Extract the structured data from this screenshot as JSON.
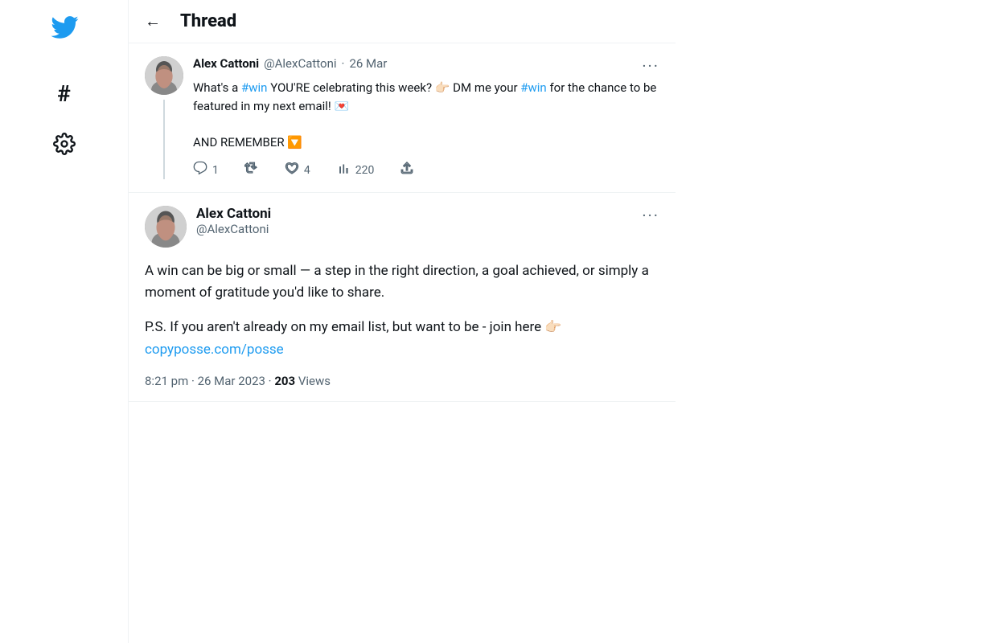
{
  "sidebar": {
    "logo": "🐦",
    "items": [
      {
        "icon": "#",
        "name": "explore",
        "label": "Explore"
      },
      {
        "icon": "⚙",
        "name": "settings",
        "label": "Settings"
      }
    ]
  },
  "header": {
    "back_label": "←",
    "title": "Thread"
  },
  "tweet1": {
    "author_name": "Alex Cattoni",
    "author_handle": "@AlexCattoni",
    "date": "26 Mar",
    "body_before_win1": "What's a ",
    "win_link1": "#win",
    "body_middle": " YOU'RE celebrating this week? 👉🏻 DM me your ",
    "win_link2": "#win",
    "body_after": " for the chance to be featured in my next email! 💌",
    "body2": "AND REMEMBER 🔽",
    "actions": {
      "reply_count": "1",
      "retweet_count": "",
      "like_count": "4",
      "views_count": "220"
    }
  },
  "tweet2": {
    "author_name": "Alex Cattoni",
    "author_handle": "@AlexCattoni",
    "body1": "A win can be big or small — a step in the right direction, a goal achieved, or simply a moment of gratitude you'd like to share.",
    "body2_before": "P.S. If you aren't already on my email list, but want to be - join here 👉🏻",
    "body2_link": "copyposse.com/posse",
    "timestamp": "8:21 pm · 26 Mar 2023 · ",
    "views_bold": "203",
    "views_text": " Views"
  }
}
